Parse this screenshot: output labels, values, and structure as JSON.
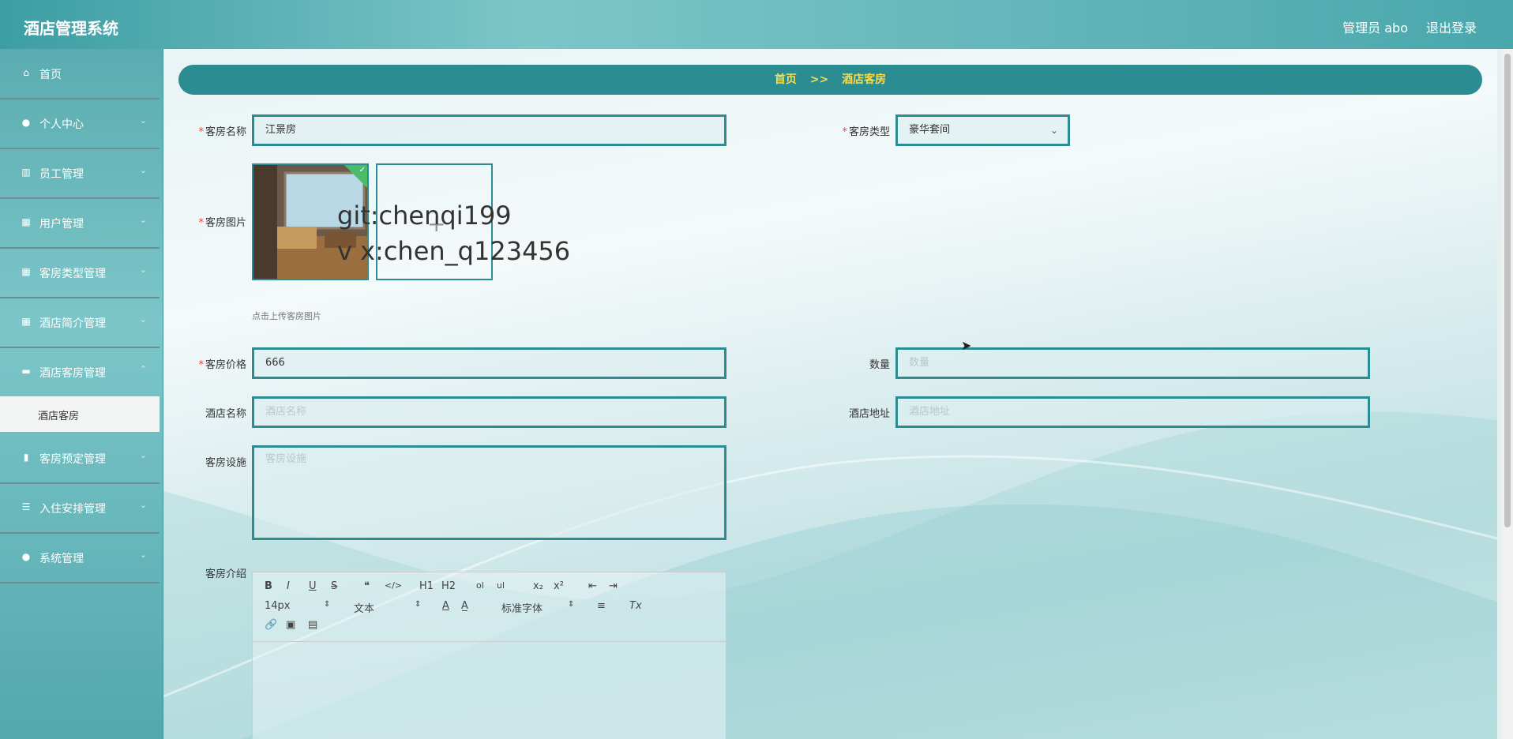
{
  "app": {
    "title": "酒店管理系统"
  },
  "topbar": {
    "user_label": "管理员 abo",
    "logout_label": "退出登录"
  },
  "sidebar": {
    "items": [
      {
        "label": "首页",
        "icon": "home-icon"
      },
      {
        "label": "个人中心",
        "icon": "user-icon"
      },
      {
        "label": "员工管理",
        "icon": "library-icon"
      },
      {
        "label": "用户管理",
        "icon": "grid-icon"
      },
      {
        "label": "客房类型管理",
        "icon": "grid-icon"
      },
      {
        "label": "酒店简介管理",
        "icon": "grid-icon"
      },
      {
        "label": "酒店客房管理",
        "icon": "comment-icon"
      },
      {
        "label": "客房预定管理",
        "icon": "chart-icon"
      },
      {
        "label": "入住安排管理",
        "icon": "sliders-icon"
      },
      {
        "label": "系统管理",
        "icon": "user-icon"
      }
    ],
    "active_sub": "酒店客房"
  },
  "breadcrumb": {
    "home": "首页",
    "sep": ">>",
    "current": "酒店客房"
  },
  "form": {
    "room_name": {
      "label": "客房名称",
      "value": "江景房"
    },
    "room_type": {
      "label": "客房类型",
      "value": "豪华套间"
    },
    "room_image": {
      "label": "客房图片",
      "hint": "点击上传客房图片"
    },
    "room_price": {
      "label": "客房价格",
      "value": "666"
    },
    "quantity": {
      "label": "数量",
      "placeholder": "数量"
    },
    "hotel_name": {
      "label": "酒店名称",
      "placeholder": "酒店名称"
    },
    "hotel_address": {
      "label": "酒店地址",
      "placeholder": "酒店地址"
    },
    "facilities": {
      "label": "客房设施",
      "placeholder": "客房设施"
    },
    "intro": {
      "label": "客房介绍"
    }
  },
  "editor": {
    "font_size": "14px",
    "text_style": "文本",
    "font_family": "标准字体",
    "buttons": [
      "B",
      "I",
      "U",
      "S",
      "❝",
      "</>",
      "H1",
      "H2",
      "ol",
      "ul",
      "x₂",
      "x²",
      "⇤",
      "⇥",
      "A",
      "A̲",
      "≡",
      "Tx",
      "link",
      "image",
      "video"
    ]
  },
  "watermark": {
    "line1": "git:chenqi199",
    "line2": "v x:chen_q123456"
  },
  "colors": {
    "accent": "#2b8c91",
    "breadcrumb_text": "#f7dc4b"
  }
}
